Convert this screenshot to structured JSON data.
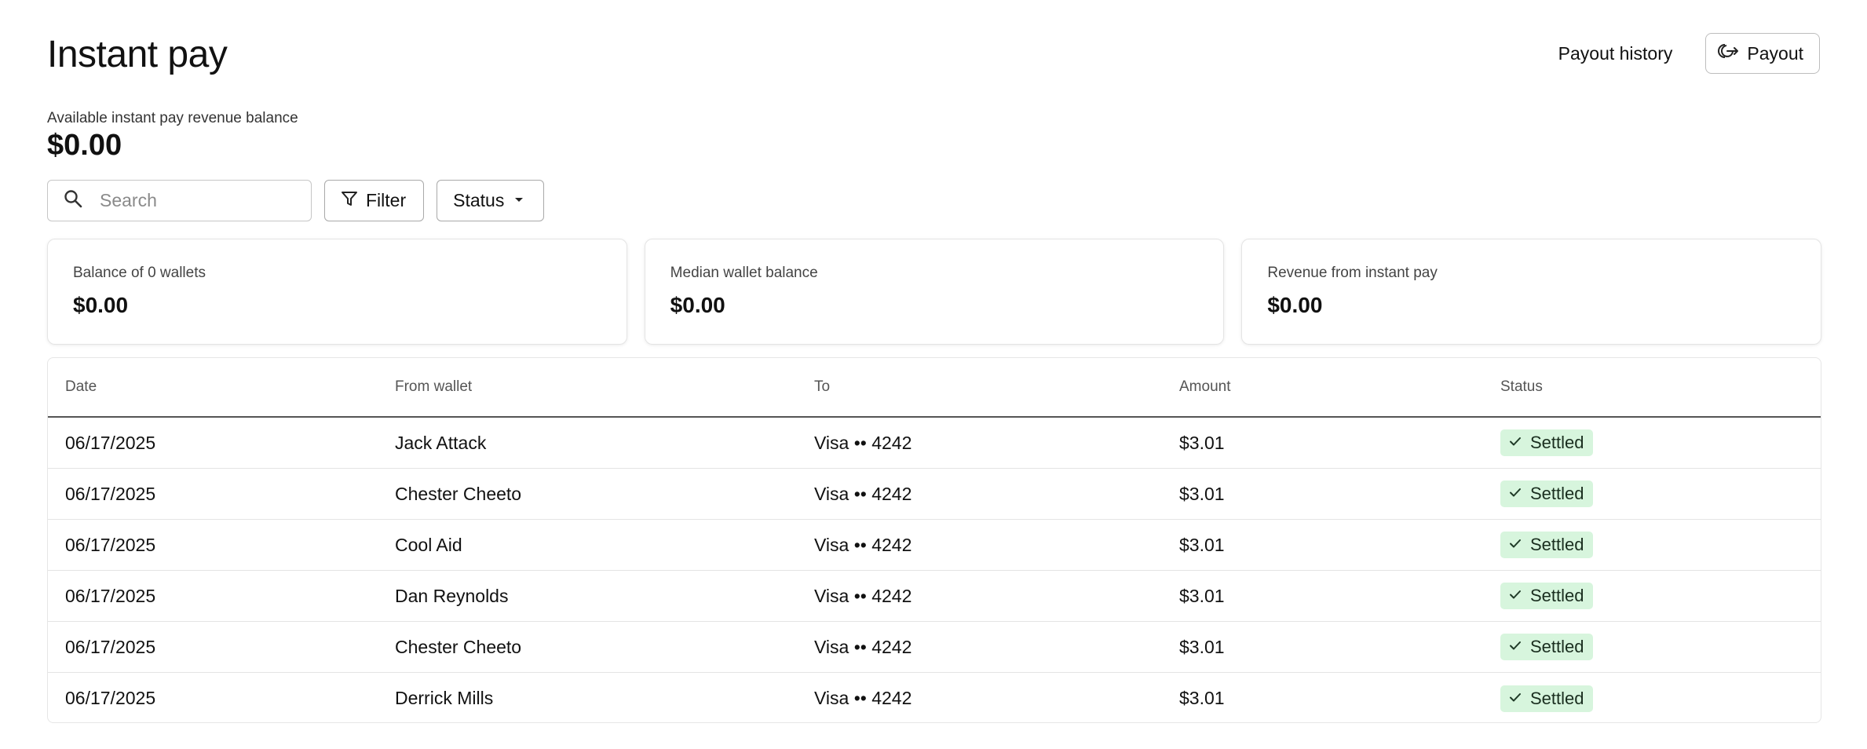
{
  "header": {
    "title": "Instant pay",
    "history_label": "Payout history",
    "payout_label": "Payout"
  },
  "balance": {
    "label": "Available instant pay revenue balance",
    "value": "$0.00"
  },
  "toolbar": {
    "search_placeholder": "Search",
    "filter_label": "Filter",
    "status_label": "Status"
  },
  "cards": [
    {
      "label": "Balance of 0 wallets",
      "value": "$0.00"
    },
    {
      "label": "Median wallet balance",
      "value": "$0.00"
    },
    {
      "label": "Revenue from instant pay",
      "value": "$0.00"
    }
  ],
  "table": {
    "columns": [
      "Date",
      "From wallet",
      "To",
      "Amount",
      "Status"
    ],
    "rows": [
      {
        "date": "06/17/2025",
        "from": "Jack Attack",
        "to": "Visa •• 4242",
        "amount": "$3.01",
        "status": "Settled"
      },
      {
        "date": "06/17/2025",
        "from": "Chester Cheeto",
        "to": "Visa •• 4242",
        "amount": "$3.01",
        "status": "Settled"
      },
      {
        "date": "06/17/2025",
        "from": "Cool Aid",
        "to": "Visa •• 4242",
        "amount": "$3.01",
        "status": "Settled"
      },
      {
        "date": "06/17/2025",
        "from": "Dan Reynolds",
        "to": "Visa •• 4242",
        "amount": "$3.01",
        "status": "Settled"
      },
      {
        "date": "06/17/2025",
        "from": "Chester Cheeto",
        "to": "Visa •• 4242",
        "amount": "$3.01",
        "status": "Settled"
      },
      {
        "date": "06/17/2025",
        "from": "Derrick Mills",
        "to": "Visa •• 4242",
        "amount": "$3.01",
        "status": "Settled"
      }
    ]
  },
  "colors": {
    "badge_bg": "#d7f5dd",
    "text": "#111111"
  },
  "icons": {
    "payout": "payout-icon",
    "search": "search-icon",
    "filter": "filter-icon",
    "status": "caret-down-icon",
    "settled": "check-icon"
  }
}
